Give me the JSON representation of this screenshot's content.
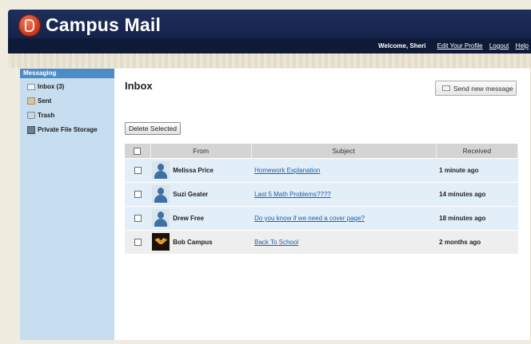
{
  "app": {
    "title": "Campus Mail"
  },
  "nav": {
    "welcome": "Welcome, Sheri",
    "links": [
      "Edit Your Profile",
      "Logout",
      "Help"
    ]
  },
  "sidebar": {
    "heading": "Messaging",
    "items": [
      {
        "label": "Inbox (3)",
        "icon": "inbox-icon"
      },
      {
        "label": "Sent",
        "icon": "sent-icon"
      },
      {
        "label": "Trash",
        "icon": "trash-icon"
      },
      {
        "label": "Private File Storage",
        "icon": "storage-icon"
      }
    ]
  },
  "main": {
    "title": "Inbox",
    "send_label": "Send new message",
    "delete_label": "Delete Selected"
  },
  "table": {
    "columns": [
      "From",
      "Subject",
      "Received"
    ],
    "rows": [
      {
        "from": "Melissa Price",
        "subject": "Homework Explanation",
        "received": "1 minute ago",
        "unread": true
      },
      {
        "from": "Suzi Geater",
        "subject": "Last 5 Math Problems????",
        "received": "14 minutes ago",
        "unread": true
      },
      {
        "from": "Drew Free",
        "subject": "Do you know if we need a cover page?",
        "received": "18 minutes ago",
        "unread": true
      },
      {
        "from": "Bob Campus",
        "subject": "Back To School",
        "received": "2 months ago",
        "unread": false
      }
    ]
  },
  "colors": {
    "header_bg": "#1e2f5c",
    "sidebar_heading_bg": "#4d8bc7",
    "sidebar_bg": "#c6def0",
    "unread_row_bg": "#e2eef8",
    "link": "#1f5fa8"
  }
}
